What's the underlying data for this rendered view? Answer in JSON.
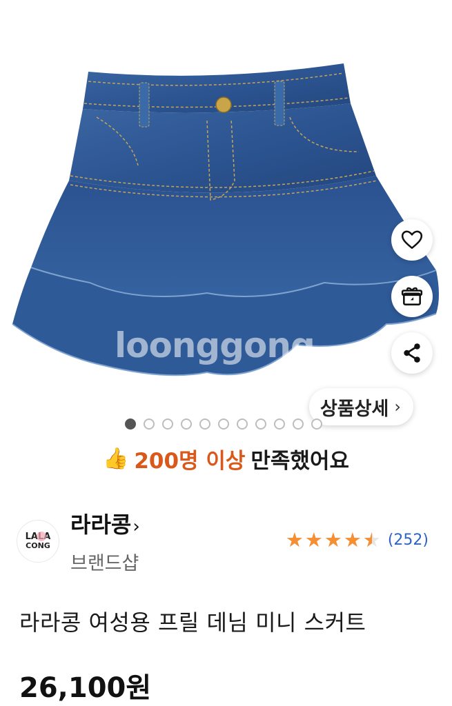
{
  "product_image": {
    "watermark": "loonggong",
    "slide_count": 11,
    "active_slide": 1
  },
  "actions": {
    "like_icon": "heart-icon",
    "gift_icon": "gift-icon",
    "share_icon": "share-icon",
    "detail_label": "상품상세",
    "detail_chevron": "›"
  },
  "satisfaction": {
    "emoji": "👍",
    "highlight": "200명 이상",
    "rest": "만족했어요",
    "highlight_color": "#d9581a"
  },
  "brand": {
    "logo_line1": "LALA",
    "logo_line2": "CONG",
    "name": "라라콩",
    "chevron": "›",
    "subtitle": "브랜드샵"
  },
  "rating": {
    "stars": 4.5,
    "review_count": "(252)",
    "star_color": "#f68e32",
    "count_color": "#2c63c4"
  },
  "product": {
    "title": "라라콩 여성용 프릴 데님 미니 스커트",
    "price": "26,100원"
  }
}
